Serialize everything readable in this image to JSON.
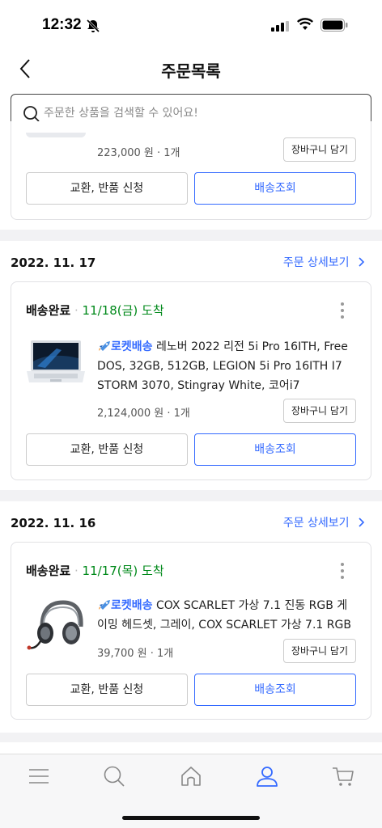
{
  "status_bar": {
    "time": "12:32"
  },
  "header": {
    "title": "주문목록",
    "back_icon": "chevron-left-icon"
  },
  "search": {
    "placeholder": "주문한 상품을 검색할 수 있어요!"
  },
  "orders": [
    {
      "price": "223,000 원 · 1개",
      "cart_label": "장바구니 담기",
      "exchange_label": "교환, 반품 신청",
      "track_label": "배송조회"
    },
    {
      "date": "2022. 11. 17",
      "detail_link": "주문 상세보기",
      "status": "배송완료",
      "arrival": "11/18(금) 도착",
      "badge": "로켓배송",
      "name": "레노버 2022 리전 5i Pro 16ITH, Free DOS, 32GB, 512GB, LEGION 5i Pro 16ITH I7 STORM 3070, Stingray White, 코어i7",
      "price": "2,124,000 원 · 1개",
      "cart_label": "장바구니 담기",
      "exchange_label": "교환, 반품 신청",
      "track_label": "배송조회"
    },
    {
      "date": "2022. 11. 16",
      "detail_link": "주문 상세보기",
      "status": "배송완료",
      "arrival": "11/17(목) 도착",
      "badge": "로켓배송",
      "name": "COX SCARLET 가상 7.1 진동 RGB 게이밍 헤드셋, 그레이, COX SCARLET 가상 7.1 RGB",
      "price": "39,700 원 · 1개",
      "cart_label": "장바구니 담기",
      "exchange_label": "교환, 반품 신청",
      "track_label": "배송조회"
    }
  ],
  "tab_bar": {
    "items": [
      "menu-icon",
      "search-icon",
      "home-icon",
      "user-icon",
      "cart-icon"
    ],
    "active": "user-icon"
  },
  "colors": {
    "accent": "#346aff",
    "arrival": "#00891a"
  }
}
